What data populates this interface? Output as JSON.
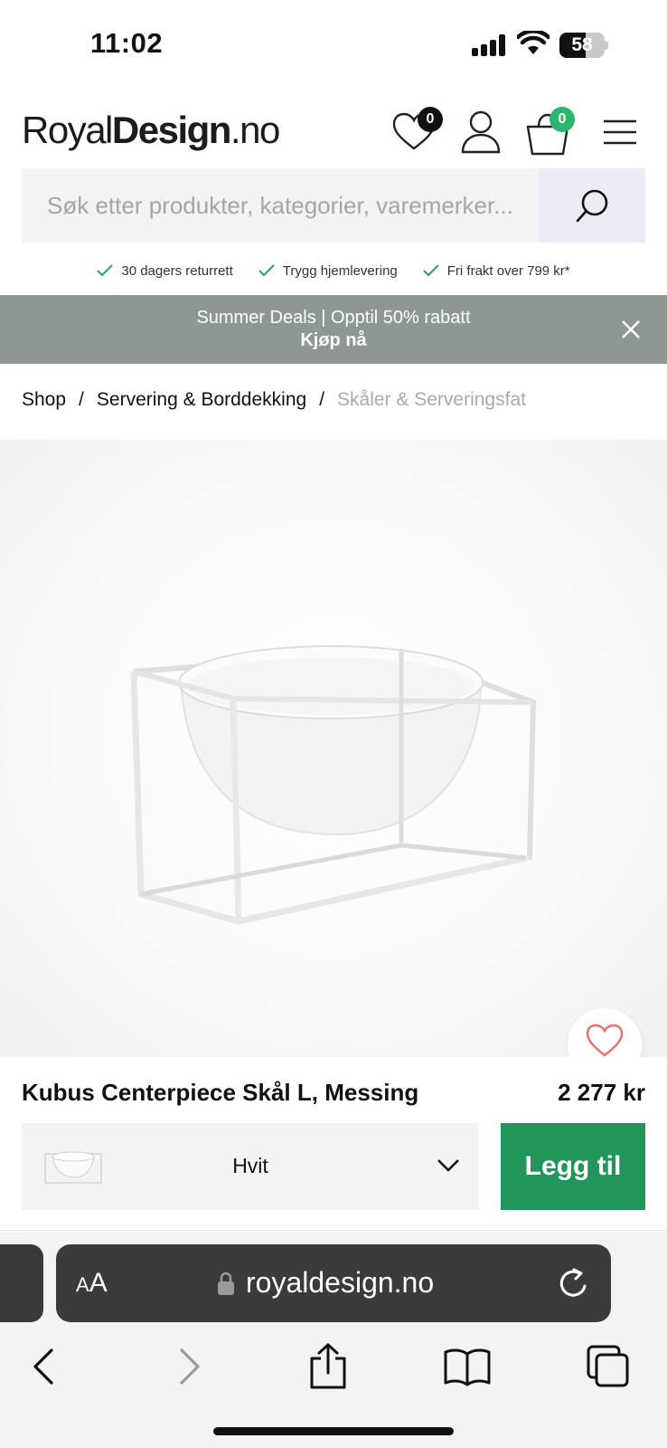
{
  "status_bar": {
    "time": "11:02",
    "battery": "58"
  },
  "header": {
    "logo": {
      "part1": "Royal",
      "part2": "Design",
      "part3": ".no"
    },
    "wishlist_count": "0",
    "cart_count": "0"
  },
  "search": {
    "placeholder": "Søk etter produkter, kategorier, varemerker..."
  },
  "usps": [
    {
      "label": "30 dagers returrett"
    },
    {
      "label": "Trygg hjemlevering"
    },
    {
      "label": "Fri frakt over 799 kr*"
    }
  ],
  "promo": {
    "line1": "Summer Deals | Opptil 50% rabatt",
    "line2": "Kjøp nå"
  },
  "breadcrumb": [
    {
      "label": "Shop"
    },
    {
      "sep": "/"
    },
    {
      "label": "Servering & Borddekking"
    },
    {
      "sep": "/"
    },
    {
      "label": "Skåler & Serveringsfat"
    }
  ],
  "product": {
    "title": "Kubus Centerpiece Skål L, Messing",
    "price": "2 277 kr",
    "variant": "Hvit",
    "add_label": "Legg til"
  },
  "browser": {
    "aa_small": "A",
    "aa_big": "A",
    "url": "royaldesign.no"
  },
  "colors": {
    "accent_green": "#22955b",
    "promo_bg": "#8d9892",
    "check_green": "#2f9e6a"
  },
  "icons": [
    "heart-icon",
    "user-icon",
    "basket-icon",
    "menu-icon",
    "search-icon",
    "check-icon",
    "close-icon",
    "chevron-down-icon",
    "lock-icon",
    "reload-icon",
    "back-icon",
    "forward-icon",
    "share-icon",
    "bookmarks-icon",
    "tabs-icon"
  ]
}
